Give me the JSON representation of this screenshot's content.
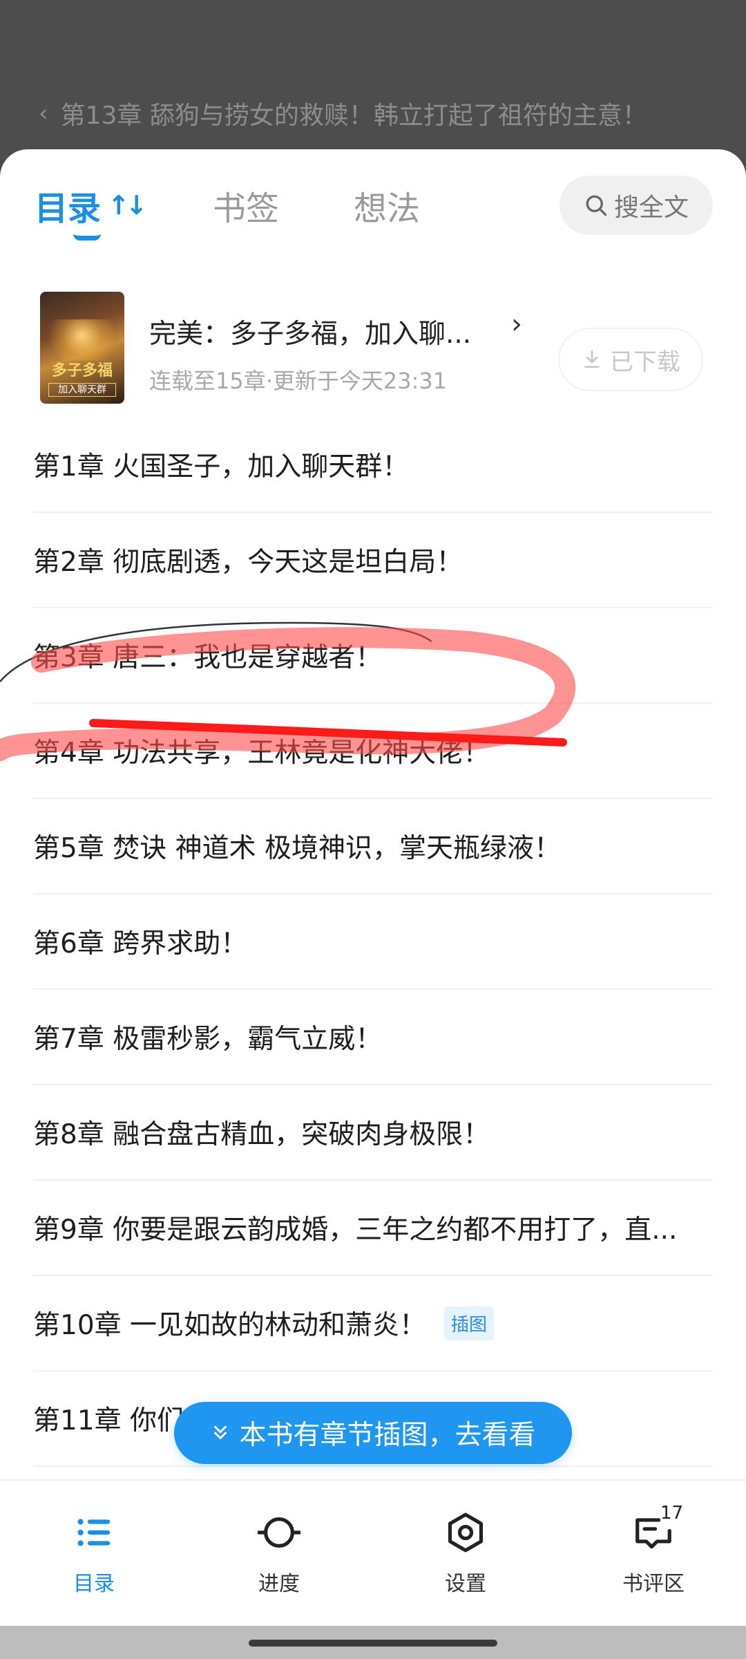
{
  "background": {
    "title": "第13章 舔狗与捞女的救赎！韩立打起了祖符的主意！"
  },
  "tabs": {
    "contents": "目录",
    "bookmarks": "书签",
    "notes": "想法",
    "search": "搜全文",
    "sort_icon": "↑↓"
  },
  "book": {
    "title": "完美：多子多福，加入聊...",
    "status": "连载至15章·更新于今天23:31",
    "download": "已下载",
    "cover_title": "多子多福",
    "cover_subtitle": "加入聊天群"
  },
  "chapters": [
    {
      "title": "第1章 火国圣子，加入聊天群！"
    },
    {
      "title": "第2章 彻底剧透，今天这是坦白局！"
    },
    {
      "title": "第3章 唐三：我也是穿越者！"
    },
    {
      "title": "第4章 功法共享，王林竟是化神大佬！"
    },
    {
      "title": "第5章 焚诀 神道术 极境神识，掌天瓶绿液！"
    },
    {
      "title": "第6章 跨界求助！"
    },
    {
      "title": "第7章 极雷秒影，霸气立威！"
    },
    {
      "title": "第8章 融合盘古精血，突破肉身极限！"
    },
    {
      "title": "第9章 你要是跟云韵成婚，三年之约都不用打了，直..."
    },
    {
      "title": "第10章 一见如故的林动和萧炎！",
      "badge": "插图"
    },
    {
      "title": "第11章 你们"
    }
  ],
  "floating_banner": "本书有章节插图，去看看",
  "bottom_nav": {
    "contents": "目录",
    "progress": "进度",
    "settings": "设置",
    "comments": "书评区",
    "comments_count": "17"
  },
  "colors": {
    "accent": "#1b8ee8",
    "banner": "#1f96ef",
    "annotation": "#ff2020"
  }
}
